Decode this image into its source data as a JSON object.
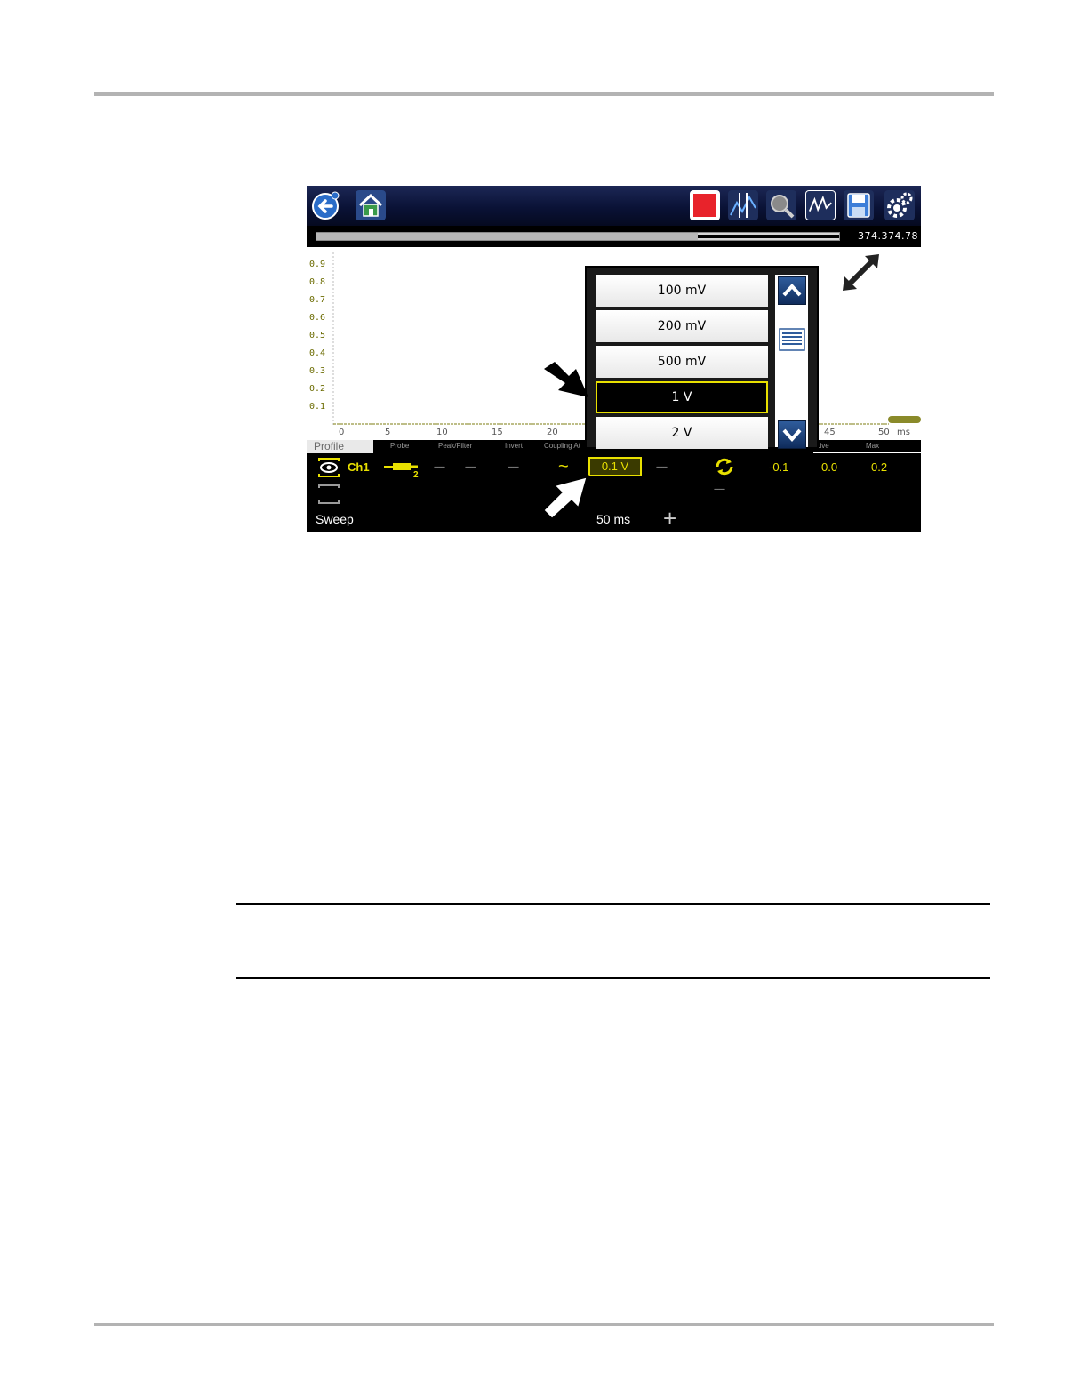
{
  "toolbar": {
    "icons": [
      "back-icon",
      "home-icon",
      "stop-icon",
      "cursors-icon",
      "zoom-icon",
      "scope-icon",
      "save-icon",
      "settings-icon"
    ]
  },
  "progress": {
    "fraction": 0.73,
    "readout": "374.374.78"
  },
  "plot": {
    "y_ticks": [
      "0.9",
      "0.8",
      "0.7",
      "0.6",
      "0.5",
      "0.4",
      "0.3",
      "0.2",
      "0.1"
    ],
    "x_ticks": [
      "0",
      "5",
      "10",
      "15",
      "20",
      "45",
      "50"
    ],
    "x_unit": "ms"
  },
  "headers": {
    "profile": "Profile",
    "probe": "Probe",
    "peak_filter": "Peak/Filter",
    "invert": "Invert",
    "coupling": "Coupling At",
    "live": "Live",
    "max": "Max"
  },
  "channel": {
    "name": "Ch1",
    "probe_value": "------",
    "peak_value": "------",
    "invert_value": "------",
    "coupling_symbol": "~",
    "scale_value": "0.1 V",
    "offset_value": "------",
    "trigger_value": "------",
    "min_value": "-0.1",
    "live_value": "0.0",
    "max_value": "0.2",
    "sweep_label": "Sweep",
    "sweep_value": "50 ms",
    "sweep_plus": "+"
  },
  "dropdown": {
    "options": [
      "100 mV",
      "200 mV",
      "500 mV",
      "1 V",
      "2 V"
    ],
    "selected": "1 V"
  }
}
